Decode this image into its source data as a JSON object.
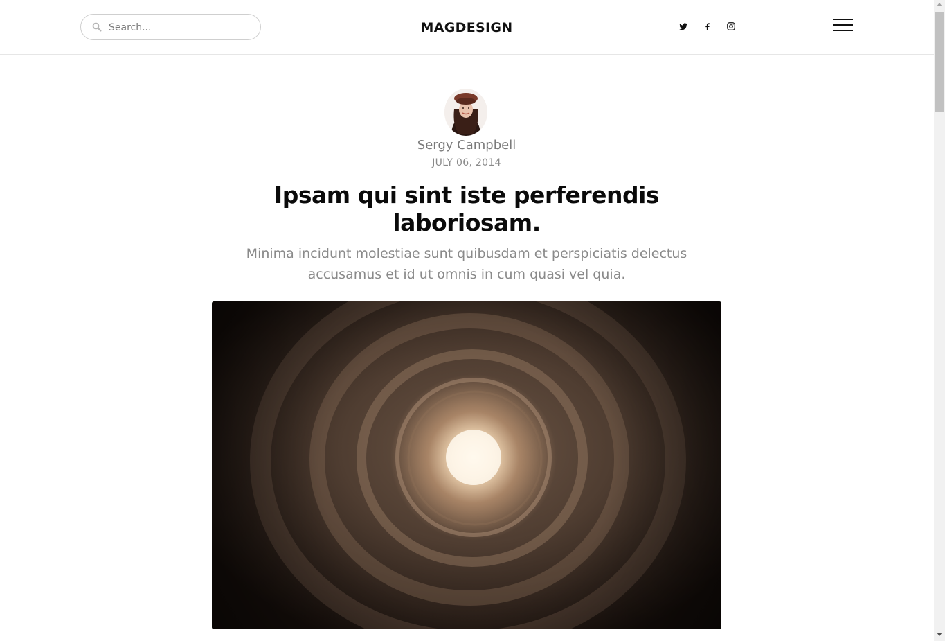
{
  "header": {
    "search": {
      "placeholder": "Search...",
      "value": ""
    },
    "brand": "MAGDESIGN",
    "social": [
      {
        "name": "twitter-icon"
      },
      {
        "name": "facebook-icon"
      },
      {
        "name": "instagram-icon"
      }
    ],
    "menu": "hamburger-menu-icon"
  },
  "article": {
    "author": "Sergy Campbell",
    "date": "JULY 06, 2014",
    "title": "Ipsam qui sint iste perferendis laboriosam.",
    "subtitle": "Minima incidunt molestiae sunt quibusdam et perspiciatis delectus accusamus et id ut omnis in cum quasi vel quia."
  },
  "colors": {
    "text_dark": "#0a0a0a",
    "text_muted": "#8a8a8a",
    "border": "#cfcfcf"
  }
}
